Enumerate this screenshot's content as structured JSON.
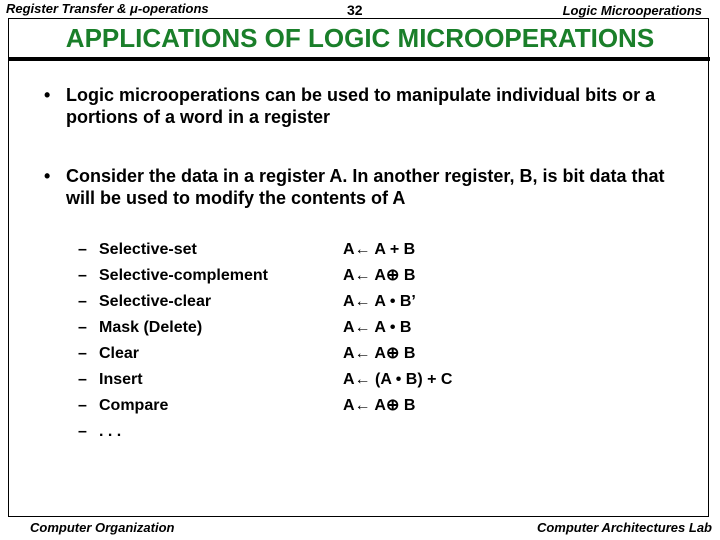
{
  "header": {
    "left": "Register Transfer & μ-operations",
    "page_number": "32",
    "right": "Logic Microoperations"
  },
  "title": "APPLICATIONS OF LOGIC MICROOPERATIONS",
  "colors": {
    "title": "#1a7f2a"
  },
  "bullets": [
    {
      "marker": "•",
      "text": "Logic microoperations can be used to manipulate individual bits or a portions of a word in a register"
    },
    {
      "marker": "•",
      "text": "Consider the data in a register A. In another register, B, is bit data that will be used to modify the contents of A"
    }
  ],
  "operations": [
    {
      "marker": "–",
      "name": "Selective-set",
      "expr": "A← A + B"
    },
    {
      "marker": "–",
      "name": "Selective-complement",
      "expr": "A← A⊕ B"
    },
    {
      "marker": "–",
      "name": "Selective-clear",
      "expr": "A← A • B’"
    },
    {
      "marker": "–",
      "name": "Mask (Delete)",
      "expr": "A← A • B"
    },
    {
      "marker": "–",
      "name": "Clear",
      "expr": "A← A⊕ B"
    },
    {
      "marker": "–",
      "name": "Insert",
      "expr": "A← (A • B) + C"
    },
    {
      "marker": "–",
      "name": "Compare",
      "expr": "A← A⊕ B"
    },
    {
      "marker": "–",
      "name": ". . .",
      "expr": ""
    }
  ],
  "footer": {
    "left": "Computer Organization",
    "right": "Computer Architectures Lab"
  }
}
